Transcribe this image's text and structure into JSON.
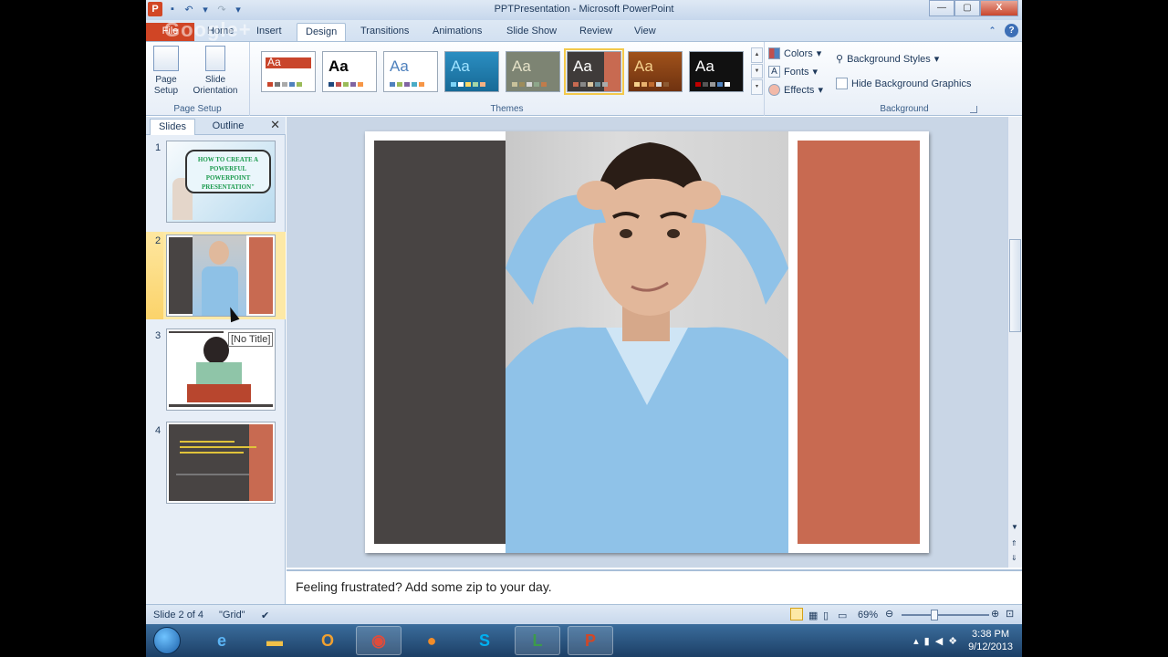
{
  "window": {
    "title": "PPTPresentation  -  Microsoft PowerPoint",
    "minimize": "—",
    "maximize": "▢",
    "close": "X"
  },
  "tabs": [
    "File",
    "Home",
    "Insert",
    "Design",
    "Transitions",
    "Animations",
    "Slide Show",
    "Review",
    "View"
  ],
  "active_tab": "Design",
  "ribbon": {
    "page_setup": {
      "page_setup_label": "Page Setup",
      "orientation_label": "Slide Orientation",
      "group": "Page Setup"
    },
    "themes": {
      "group": "Themes",
      "sample": "Aa"
    },
    "colors": "Colors",
    "fonts": "Fonts",
    "effects": "Effects",
    "background_styles": "Background Styles",
    "hide_background": "Hide Background Graphics",
    "background_group": "Background"
  },
  "pane": {
    "slides_tab": "Slides",
    "outline_tab": "Outline",
    "slides": [
      {
        "num": "1",
        "title": "HOW TO CREATE A POWERFUL POWERPOINT PRESENTATION\""
      },
      {
        "num": "2"
      },
      {
        "num": "3"
      },
      {
        "num": "4"
      }
    ],
    "tooltip": "[No Title]"
  },
  "notes": "Feeling frustrated?  Add some zip to your day.",
  "status": {
    "slide": "Slide 2 of 4",
    "theme": "\"Grid\"",
    "zoom": "69%"
  },
  "taskbar": {
    "time": "3:38 PM",
    "date": "9/12/2013",
    "watermark": "Google+"
  },
  "colors": {
    "file_tab": "#d04525",
    "dark_panel": "#484443",
    "accent_panel": "#c86a51",
    "selected": "#f3c94b"
  }
}
